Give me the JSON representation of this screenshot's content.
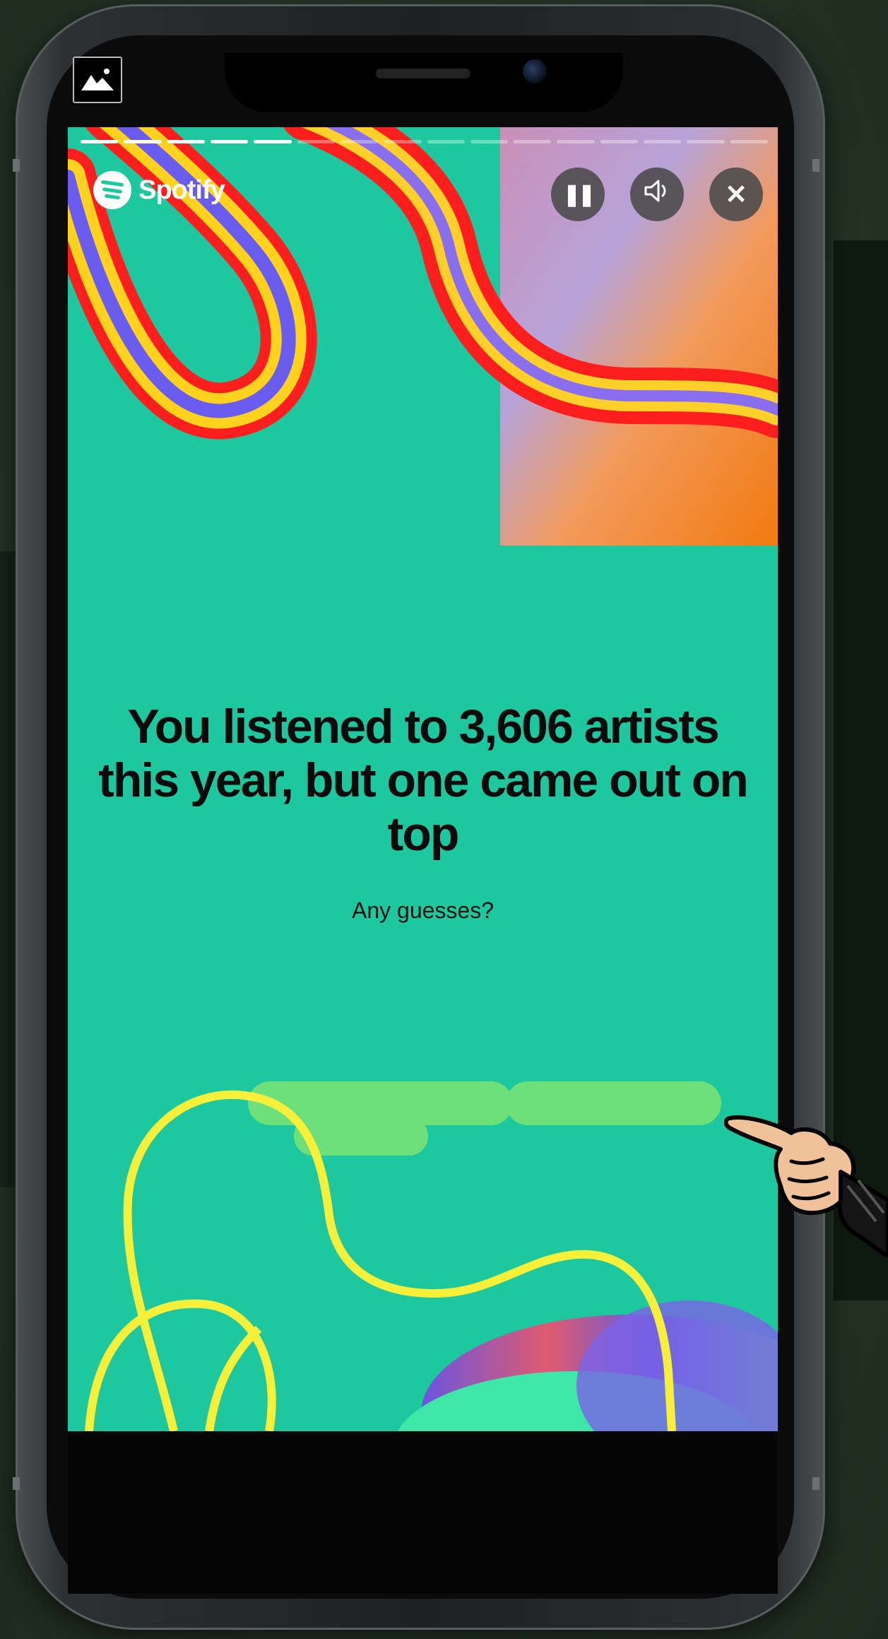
{
  "app": {
    "brand": "Spotify"
  },
  "story": {
    "progress_total": 16,
    "progress_done": 5,
    "headline": "You listened to 3,606 artists this year, but one came out on top",
    "subtext": "Any guesses?",
    "background_color": "#1ec89e"
  },
  "controls": {
    "pause_icon": "❚❚",
    "sound_icon": "🔈",
    "close_icon": "✕"
  },
  "icons": {
    "corner": "mountain-image-icon",
    "pause": "pause-icon",
    "sound": "speaker-icon",
    "close": "close-icon",
    "pointer": "pointing-hand-icon"
  }
}
